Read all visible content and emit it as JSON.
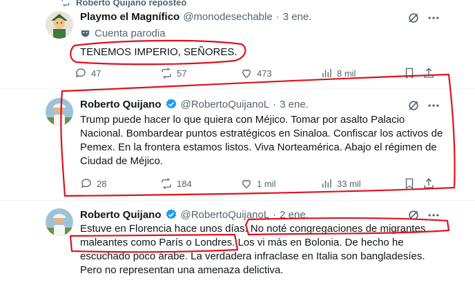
{
  "repost": {
    "label": "Roberto Quijano reposteó"
  },
  "tweets": [
    {
      "name": "Playmo el Magnífico",
      "handle": "@monodesechable",
      "dot": "·",
      "time": "3 ene.",
      "parody_label": "Cuenta parodia",
      "text": "TENEMOS IMPERIO, SEÑORES.",
      "replies": "47",
      "reposts": "57",
      "likes": "473",
      "views": "8 mil"
    },
    {
      "name": "Roberto Quijano",
      "handle": "@RobertoQuijanoL",
      "dot": "·",
      "time": "3 ene.",
      "text": "Trump puede hacer lo que quiera con Méjico. Tomar por asalto Palacio Nacional. Bombardear puntos estratégicos en Sinaloa. Confiscar los activos de Pemex. En la frontera estamos listos. Viva Norteamérica. Abajo el régimen de Ciudad de Méjico.",
      "replies": "28",
      "reposts": "184",
      "likes": "1 mil",
      "views": "33 mil"
    },
    {
      "name": "Roberto Quijano",
      "handle": "@RobertoQuijanoL",
      "dot": "·",
      "time": "2 ene.",
      "text": "Estuve en Florencia hace unos días. No noté congregaciones de migrantes maleantes como París o Londres. Los vi más en Bolonia. De hecho he escuchado poco árabe. La verdadera infraclase en Italia son bangladesíes. Pero no representan una amenaza delictiva."
    }
  ],
  "colors": {
    "annotation": "#e0101c",
    "verified": "#1d9bf0",
    "muted": "#536471"
  }
}
